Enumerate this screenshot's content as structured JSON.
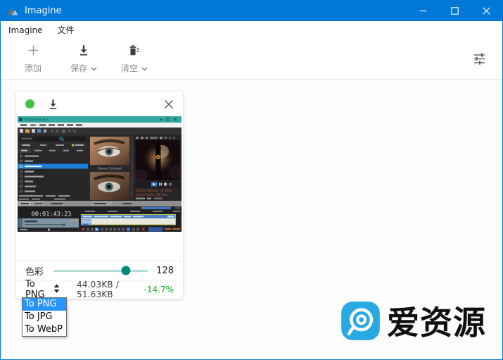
{
  "window": {
    "title": "Imagine",
    "titlebar_color": "#0078d7"
  },
  "menubar": {
    "items": [
      "Imagine",
      "文件"
    ]
  },
  "toolbar": {
    "add_label": "添加",
    "save_label": "保存",
    "clear_label": "清空",
    "icons": [
      "plus-icon",
      "download-icon",
      "trash-icon",
      "tune-icon"
    ]
  },
  "card": {
    "status_color": "#41c541",
    "thumbnail": {
      "description": "VEGAS Pro video editor screenshot",
      "app_title": "VEGAS Pro 16.0",
      "preset_label": "Heavy Contrast",
      "timecode": "00:01:43:23",
      "props_line1": "1920x1080x32, 59.940p",
      "props_line2": "480x270x32, 59.940p"
    },
    "slider": {
      "label": "色彩",
      "value": "128",
      "percent": 77,
      "accent": "#00897b"
    },
    "format_value": "To PNG",
    "size_text": "44.03KB / 51.63KB",
    "savings_text": "-14.7%",
    "savings_color": "#0cb41e"
  },
  "dropdown": {
    "options": [
      "To PNG",
      "To JPG",
      "To WebP"
    ],
    "selected_index": 0,
    "highlight_color": "#2693ff"
  },
  "watermark": {
    "text": "爱资源",
    "logo_color": "#29a9e1"
  }
}
